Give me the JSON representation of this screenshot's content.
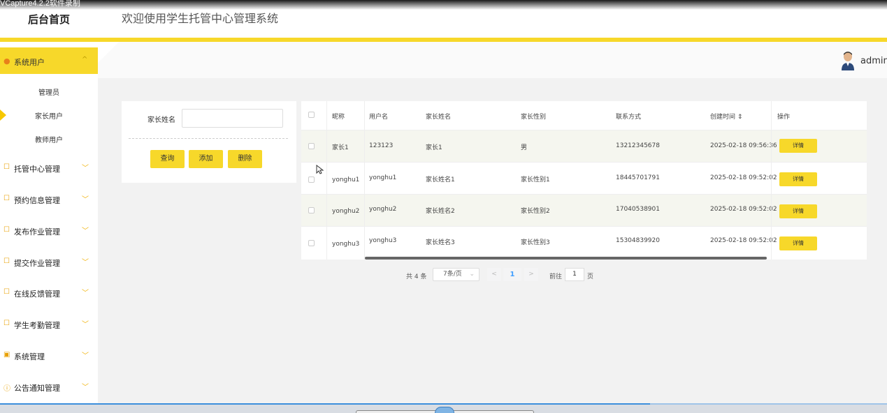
{
  "recorder_label": "VCapture4.2.2软件录制",
  "header": {
    "brand": "后台首页",
    "welcome": "欢迎使用学生托管中心管理系统",
    "username": "admin"
  },
  "sidebar": {
    "active": {
      "label": "系统用户",
      "caret": "^"
    },
    "subitems": [
      {
        "label": "管理员"
      },
      {
        "label": "家长用户"
      },
      {
        "label": "教师用户"
      }
    ],
    "items": [
      {
        "label": "托管中心管理"
      },
      {
        "label": "预约信息管理"
      },
      {
        "label": "发布作业管理"
      },
      {
        "label": "提交作业管理"
      },
      {
        "label": "在线反馈管理"
      },
      {
        "label": "学生考勤管理"
      },
      {
        "label": "系统管理"
      },
      {
        "label": "公告通知管理"
      }
    ],
    "caret_down": "﹀"
  },
  "search": {
    "label": "家长姓名",
    "placeholder": "",
    "buttons": {
      "query": "查询",
      "add": "添加",
      "delete": "删除"
    }
  },
  "table": {
    "columns": [
      "昵称",
      "用户名",
      "家长姓名",
      "家长性别",
      "联系方式",
      "创建时间 ⇕",
      "操作"
    ],
    "rows": [
      [
        "家长1",
        "123123",
        "家长1",
        "男",
        "13212345678",
        "2025-02-18 09:56:36"
      ],
      [
        "yonghu1",
        "yonghu1",
        "家长姓名1",
        "家长性别1",
        "18445701791",
        "2025-02-18 09:52:02"
      ],
      [
        "yonghu2",
        "yonghu2",
        "家长姓名2",
        "家长性别2",
        "17040538901",
        "2025-02-18 09:52:02"
      ],
      [
        "yonghu3",
        "yonghu3",
        "家长姓名3",
        "家长性别3",
        "15304839920",
        "2025-02-18 09:52:02"
      ]
    ],
    "action_label": "详情"
  },
  "pager": {
    "total": "共 4 条",
    "page_size": "7条/页",
    "current": "1",
    "prev": "<",
    "next": ">",
    "goto_prefix": "前往",
    "goto_value": "1",
    "goto_suffix": "页"
  },
  "colors": {
    "accent": "#f7d82a",
    "sidebar_bg": "#ffffff",
    "content_bg": "#f2f2f2"
  }
}
